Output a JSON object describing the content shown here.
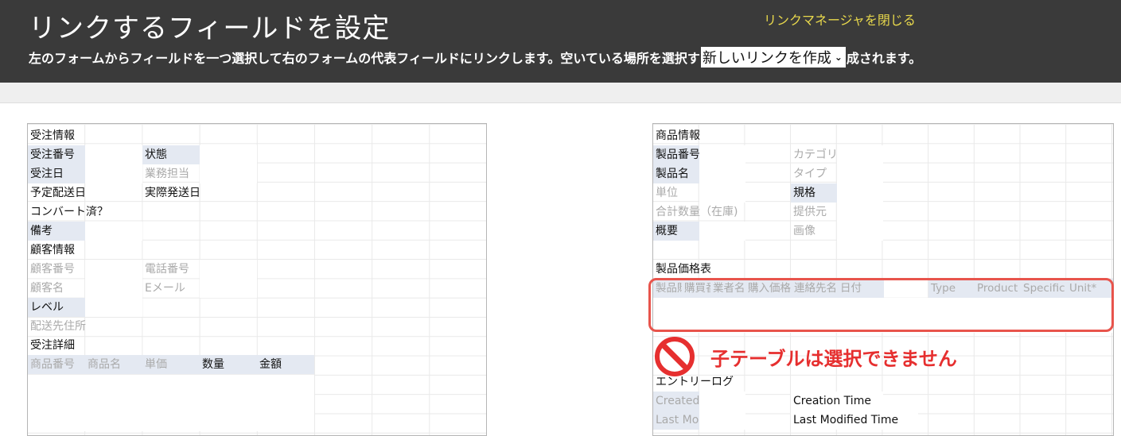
{
  "header": {
    "title": "リンクするフィールドを設定",
    "close_link": "リンクマネージャを閉じる",
    "instruction_before": "左のフォームからフィールドを一つ選択して右のフォームの代表フィールドにリンクします。空いている場所を選択す",
    "link_select_value": "新しいリンクを作成",
    "instruction_after": "成されます。"
  },
  "left_form": {
    "order_section": "受注情報",
    "order_no": "受注番号",
    "status": "状態",
    "order_date": "受注日",
    "staff": "業務担当",
    "planned_ship": "予定配送日",
    "actual_ship": "実際発送日",
    "converted": "コンバート済？",
    "notes": "備考",
    "customer_section": "顧客情報",
    "customer_no": "顧客番号",
    "phone": "電話番号",
    "customer_name": "顧客名",
    "email": "Eメール",
    "level": "レベル",
    "ship_address": "配送先住所",
    "detail_section": "受注詳細",
    "detail_cols": [
      "商品番号",
      "商品名",
      "単価",
      "数量",
      "金額"
    ]
  },
  "right_form": {
    "product_section": "商品情報",
    "product_no": "製品番号",
    "category": "カテゴリー",
    "product_name": "製品名",
    "type": "タイプ",
    "unit": "単位",
    "spec": "規格",
    "total_stock": "合計数量（在庫)",
    "supplier": "提供元",
    "overview": "概要",
    "image": "画像",
    "price_section": "製品価格表",
    "price_cols": [
      "製品購買番号",
      "購買番号",
      "業者名",
      "購入価格",
      "連絡先名",
      "日付",
      "Type",
      "Product",
      "Specific",
      "Unit*"
    ],
    "entry_section": "エントリーログ",
    "created": "Created",
    "creation_time": "Creation Time",
    "last_mod": "Last Mod",
    "last_modified_time": "Last Modified Time"
  },
  "warning": {
    "text": "子テーブルは選択できません",
    "icon": "prohibited-icon"
  },
  "colors": {
    "header_bg": "#3a3a3a",
    "link_yellow": "#e8d84c",
    "highlight_red": "#e8544c",
    "label_bg": "#e4e9f2"
  }
}
